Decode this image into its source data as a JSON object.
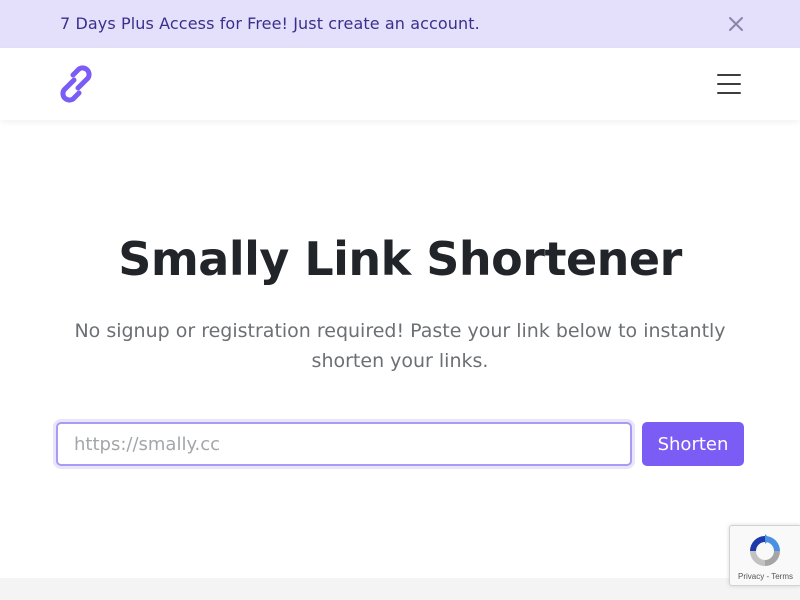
{
  "promo": {
    "text": "7 Days Plus Access for Free! Just create an account.",
    "close_icon": "close-icon"
  },
  "navbar": {
    "logo_icon": "chain-link-icon",
    "menu_icon": "hamburger-menu-icon"
  },
  "hero": {
    "title": "Smally Link Shortener",
    "subtitle": "No signup or registration required! Paste your link below to instantly shorten your links."
  },
  "form": {
    "url_placeholder": "https://smally.cc",
    "url_value": "",
    "submit_label": "Shorten"
  },
  "recaptcha": {
    "icon": "recaptcha-icon",
    "privacy_label": "Privacy",
    "separator": " - ",
    "terms_label": "Terms"
  },
  "colors": {
    "accent": "#7b5cf5",
    "promo_background": "#e4e0fb",
    "promo_text": "#3a2f8c",
    "input_border": "#a89bf2"
  }
}
